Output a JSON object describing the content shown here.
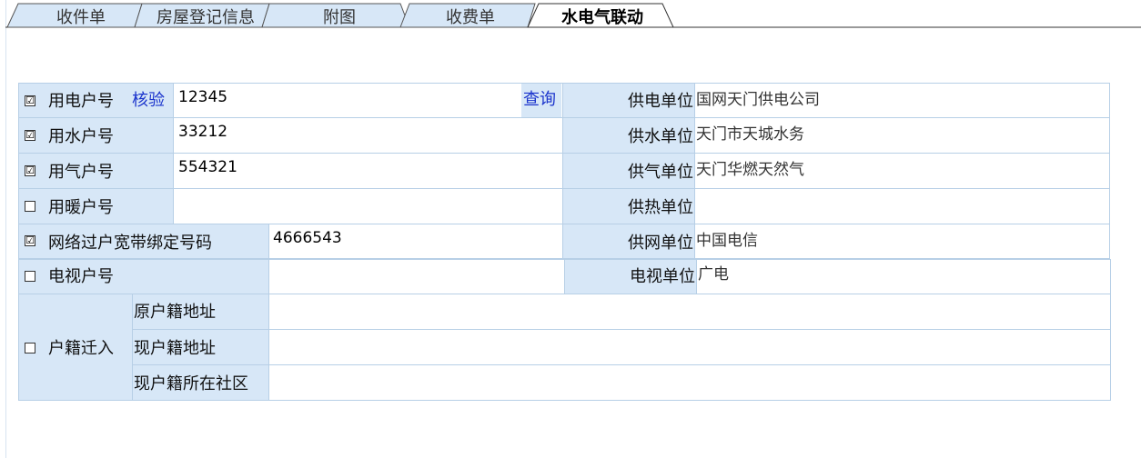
{
  "tabs": [
    {
      "label": "收件单"
    },
    {
      "label": "房屋登记信息"
    },
    {
      "label": "附图"
    },
    {
      "label": "收费单"
    },
    {
      "label": "水电气联动"
    }
  ],
  "rows": {
    "electric": {
      "checked": "☑",
      "label": "用电户号",
      "verify": "核验",
      "value": "12345",
      "query": "查询",
      "unit_label": "供电单位",
      "unit_value": "国网天门供电公司"
    },
    "water": {
      "checked": "☑",
      "label": "用水户号",
      "value": "33212",
      "unit_label": "供水单位",
      "unit_value": "天门市天城水务"
    },
    "gas": {
      "checked": "☑",
      "label": "用气户号",
      "value": "554321",
      "unit_label": "供气单位",
      "unit_value": "天门华燃天然气"
    },
    "heating": {
      "checked": "",
      "label": "用暖户号",
      "value": "",
      "unit_label": "供热单位",
      "unit_value": ""
    },
    "network": {
      "checked": "☑",
      "label": "网络过户宽带绑定号码",
      "value": "4666543",
      "unit_label": "供网单位",
      "unit_value": "中国电信"
    },
    "tv": {
      "checked": "",
      "label": "电视户号",
      "value": "",
      "unit_label": "电视单位",
      "unit_value": "广电"
    },
    "household": {
      "checked": "",
      "label": "户籍迁入",
      "orig_label": "原户籍地址",
      "orig_value": "",
      "current_label": "现户籍地址",
      "current_value": "",
      "community_label": "现户籍所在社区",
      "community_value": ""
    }
  },
  "colors": {
    "shade": "#d7e7f7",
    "border": "#b7cfe6",
    "link": "#1a33cc"
  }
}
